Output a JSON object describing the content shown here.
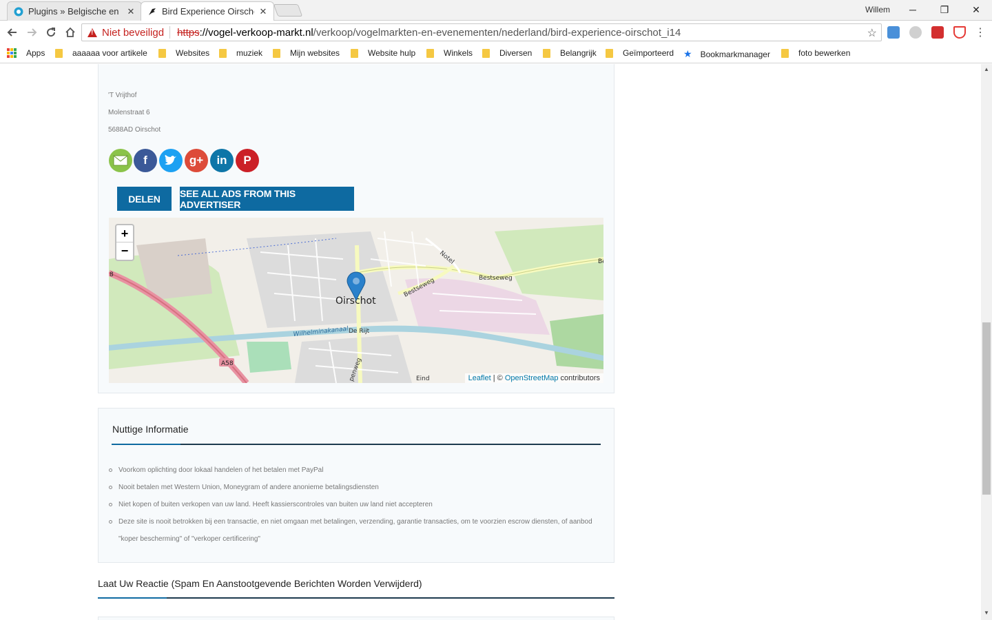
{
  "browser": {
    "tabs": [
      {
        "title": "Plugins » Belgische en Ne",
        "icon": "plugin-favicon",
        "close": "✕"
      },
      {
        "title": "Bird Experience Oirschot",
        "icon": "bird-favicon",
        "close": "✕"
      }
    ],
    "profile": "Willem",
    "security_label": "Niet beveiligd",
    "url_scheme": "https",
    "url_host": "://vogel-verkoop-markt.nl",
    "url_path": "/verkoop/vogelmarkten-en-evenementen/nederland/bird-experience-oirschot_i14",
    "bookmarks": [
      {
        "label": "Apps",
        "icon": "apps-grid-icon"
      },
      {
        "label": "aaaaaa voor artikele",
        "icon": "folder-icon"
      },
      {
        "label": "Websites",
        "icon": "folder-icon"
      },
      {
        "label": "muziek",
        "icon": "folder-icon"
      },
      {
        "label": "Mijn websites",
        "icon": "folder-icon"
      },
      {
        "label": "Website hulp",
        "icon": "folder-icon"
      },
      {
        "label": "Winkels",
        "icon": "folder-icon"
      },
      {
        "label": "Diversen",
        "icon": "folder-icon"
      },
      {
        "label": "Belangrijk",
        "icon": "folder-icon"
      },
      {
        "label": "Geïmporteerd",
        "icon": "folder-icon"
      },
      {
        "label": "Bookmarkmanager",
        "icon": "star-icon"
      },
      {
        "label": "foto bewerken",
        "icon": "folder-icon"
      }
    ]
  },
  "listing": {
    "address": [
      "'T Vrijthof",
      "Molenstraat 6",
      "5688AD Oirschot"
    ],
    "social": [
      {
        "name": "email",
        "color": "#8bc34a"
      },
      {
        "name": "facebook",
        "glyph": "f",
        "color": "#3b5998"
      },
      {
        "name": "twitter",
        "color": "#1da1f2"
      },
      {
        "name": "google-plus",
        "glyph": "g+",
        "color": "#dd4b39"
      },
      {
        "name": "linkedin",
        "glyph": "in",
        "color": "#0e76a8"
      },
      {
        "name": "pinterest",
        "glyph": "P",
        "color": "#cb2027"
      }
    ],
    "share_button": "DELEN",
    "all_ads_button": "SEE ALL ADS FROM THIS ADVERTISER"
  },
  "map": {
    "zoom_in": "+",
    "zoom_out": "−",
    "town_label": "Oirschot",
    "road_labels": [
      "Bestseweg",
      "Bestseweg",
      "Notel",
      "De Rijt",
      "Wilhelminakanaal",
      "A58",
      "8",
      "Be",
      "Eind",
      "penweg"
    ],
    "attribution_leaflet": "Leaflet",
    "attribution_sep": " | © ",
    "attribution_osm": "OpenStreetMap",
    "attribution_tail": " contributors"
  },
  "info": {
    "title": "Nuttige Informatie",
    "items": [
      "Voorkom oplichting door lokaal handelen of het betalen met PayPal",
      "Nooit betalen met Western Union, Moneygram of andere anonieme betalingsdiensten",
      "Niet kopen of buiten verkopen van uw land. Heeft kassierscontroles van buiten uw land niet accepteren",
      "Deze site is nooit betrokken bij een transactie, en niet omgaan met betalingen, verzending, garantie transacties, om te voorzien escrow diensten, of aanbod \"koper bescherming\" of \"verkoper certificering\""
    ]
  },
  "comments": {
    "title": "Laat Uw Reactie (Spam En Aanstootgevende Berichten Worden Verwijderd)"
  },
  "colors": {
    "accent": "#0e6aa1",
    "warning": "#c5221f"
  }
}
